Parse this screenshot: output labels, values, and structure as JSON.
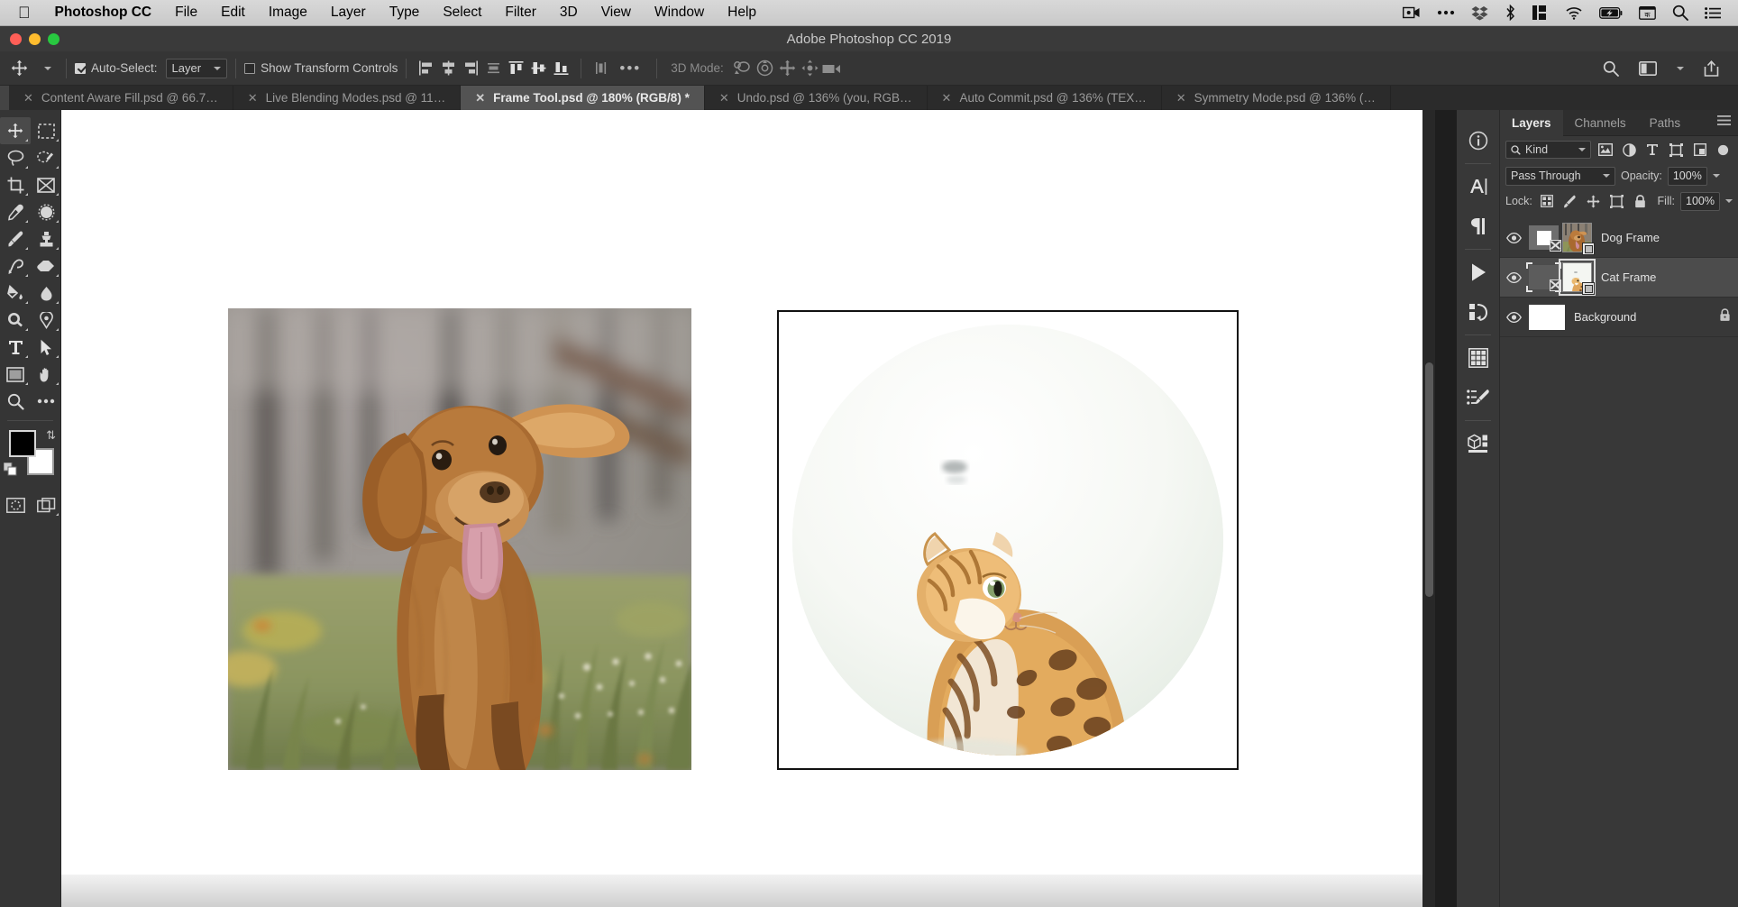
{
  "macbar": {
    "apple_icon": "apple-logo-icon",
    "app_name": "Photoshop CC",
    "menus": [
      "File",
      "Edit",
      "Image",
      "Layer",
      "Type",
      "Select",
      "Filter",
      "3D",
      "View",
      "Window",
      "Help"
    ],
    "status_icons": [
      "screen-record-icon",
      "ellipsis-icon",
      "dropbox-icon",
      "bluetooth-icon",
      "display-grid-icon",
      "wifi-icon",
      "battery-charging-icon",
      "input-source-icon",
      "spotlight-search-icon",
      "control-center-icon"
    ]
  },
  "window": {
    "title": "Adobe Photoshop CC 2019",
    "traffic_lights": [
      "close",
      "minimize",
      "zoom"
    ]
  },
  "options_bar": {
    "tool_icon": "move-tool-icon",
    "auto_select_label": "Auto-Select:",
    "auto_select_checked": true,
    "auto_select_value": "Layer",
    "show_transform_label": "Show Transform Controls",
    "show_transform_checked": false,
    "align_icons": [
      "align-left-edges-icon",
      "align-horizontal-centers-icon",
      "align-right-edges-icon",
      "align-top-edges-icon",
      "align-vertical-centers-icon",
      "align-bottom-edges-icon",
      "distribute-icon"
    ],
    "more_label": "•••",
    "mode_3d_label": "3D Mode:",
    "mode_3d_icons": [
      "rotate-3d-icon",
      "roll-3d-icon",
      "drag-3d-icon",
      "slide-3d-icon",
      "scale-3d-camera-icon"
    ],
    "right_icons": [
      "search-icon",
      "workspace-icon",
      "share-icon"
    ]
  },
  "tabs": [
    {
      "label": "Content Aware Fill.psd @ 66.7…",
      "active": false
    },
    {
      "label": "Live Blending Modes.psd @ 11…",
      "active": false
    },
    {
      "label": "Frame Tool.psd @ 180% (RGB/8) *",
      "active": true
    },
    {
      "label": "Undo.psd @ 136% (you, RGB…",
      "active": false
    },
    {
      "label": "Auto Commit.psd @ 136% (TEX…",
      "active": false
    },
    {
      "label": "Symmetry Mode.psd @ 136% (…",
      "active": false
    }
  ],
  "toolbar": {
    "tools": [
      {
        "name": "move-tool",
        "selected": true
      },
      {
        "name": "rectangular-marquee-tool",
        "selected": false
      },
      {
        "name": "lasso-tool",
        "selected": false
      },
      {
        "name": "quick-selection-tool",
        "selected": false
      },
      {
        "name": "crop-tool",
        "selected": false
      },
      {
        "name": "frame-tool",
        "selected": false
      },
      {
        "name": "eyedropper-tool",
        "selected": false
      },
      {
        "name": "spot-healing-brush-tool",
        "selected": false
      },
      {
        "name": "brush-tool",
        "selected": false
      },
      {
        "name": "clone-stamp-tool",
        "selected": false
      },
      {
        "name": "history-brush-tool",
        "selected": false
      },
      {
        "name": "eraser-tool",
        "selected": false
      },
      {
        "name": "gradient-tool",
        "selected": false
      },
      {
        "name": "blur-tool",
        "selected": false
      },
      {
        "name": "dodge-tool",
        "selected": false
      },
      {
        "name": "pen-tool",
        "selected": false
      },
      {
        "name": "type-tool",
        "selected": false
      },
      {
        "name": "path-selection-tool",
        "selected": false
      },
      {
        "name": "rectangle-tool",
        "selected": false
      },
      {
        "name": "hand-tool",
        "selected": false
      },
      {
        "name": "zoom-tool",
        "selected": false
      },
      {
        "name": "edit-toolbar-tool",
        "selected": false
      }
    ],
    "foreground_color": "#000000",
    "background_color": "#ffffff",
    "bottom_icons": [
      "quick-mask-icon",
      "screen-mode-icon"
    ]
  },
  "dock_strip": {
    "icons": [
      "info-panel-icon",
      "character-panel-icon",
      "paragraph-panel-icon",
      "actions-panel-icon",
      "history-panel-icon",
      "swatches-panel-icon",
      "brush-settings-panel-icon",
      "3d-panel-icon"
    ]
  },
  "layers_panel": {
    "tabs": [
      {
        "label": "Layers",
        "active": true
      },
      {
        "label": "Channels",
        "active": false
      },
      {
        "label": "Paths",
        "active": false
      }
    ],
    "menu_icon": "panel-menu-icon",
    "filter": {
      "search_icon": "search-icon",
      "kind_label": "Kind",
      "type_icons": [
        "filter-pixel-icon",
        "filter-adjustment-icon",
        "filter-type-icon",
        "filter-shape-icon",
        "filter-smart-object-icon"
      ],
      "toggle": "filter-toggle-switch"
    },
    "blend_mode": "Pass Through",
    "opacity_label": "Opacity:",
    "opacity_value": "100%",
    "lock_label": "Lock:",
    "lock_icons": [
      "lock-transparent-pixels-icon",
      "lock-image-pixels-icon",
      "lock-position-icon",
      "lock-artboard-nesting-icon",
      "lock-all-icon"
    ],
    "fill_label": "Fill:",
    "fill_value": "100%",
    "layers": [
      {
        "name": "Dog Frame",
        "visible": true,
        "selected": false,
        "kind": "frame",
        "locked": false
      },
      {
        "name": "Cat Frame",
        "visible": true,
        "selected": true,
        "kind": "frame",
        "locked": false
      },
      {
        "name": "Background",
        "visible": true,
        "selected": false,
        "kind": "background",
        "locked": true
      }
    ]
  },
  "canvas": {
    "zoom": "180%",
    "objects": [
      {
        "name": "dog-photo",
        "alt": "Brown retriever puppy running in a grassy field with tongue out"
      },
      {
        "name": "cat-frame",
        "alt": "Bengal cat sitting, seen in profile, inside a circular frame on white background"
      }
    ]
  },
  "colors": {
    "chrome": "#353535",
    "panel": "#383838",
    "selection": "#4c4c4c",
    "tab_active": "#535353",
    "text": "#c8c8c8"
  }
}
